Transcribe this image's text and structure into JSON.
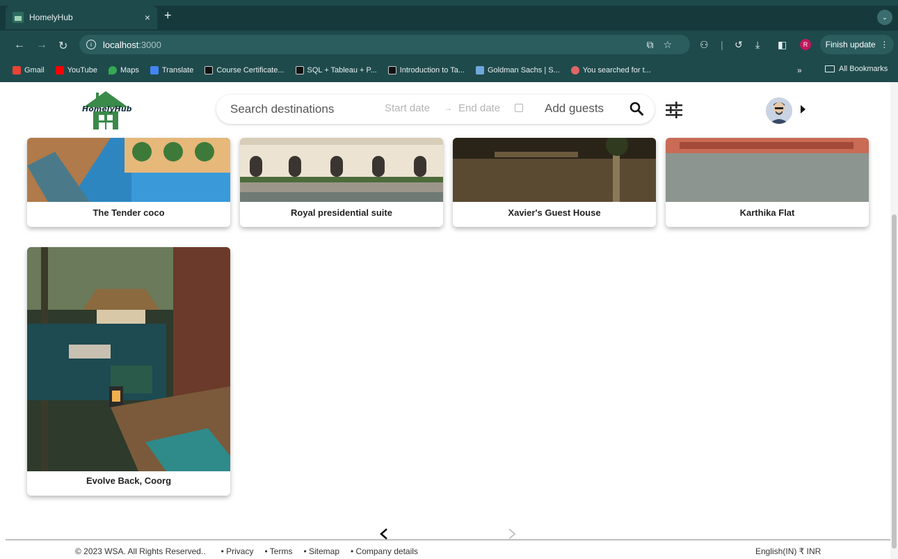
{
  "browser": {
    "tab_title": "HomelyHub",
    "tab_close": "×",
    "new_tab": "+",
    "url_host": "localhost",
    "url_port": ":3000",
    "finish_update": "Finish update",
    "profile_initial": "R",
    "bookmarks": [
      {
        "label": "Gmail",
        "color": "#ea4335"
      },
      {
        "label": "YouTube",
        "color": "#ff0000"
      },
      {
        "label": "Maps",
        "color": "#34a853"
      },
      {
        "label": "Translate",
        "color": "#4285f4"
      },
      {
        "label": "Course Certificate...",
        "color": "#111111"
      },
      {
        "label": "SQL + Tableau + P...",
        "color": "#111111"
      },
      {
        "label": "Introduction to Ta...",
        "color": "#111111"
      },
      {
        "label": "Goldman Sachs | S...",
        "color": "#6fa8dc"
      },
      {
        "label": "You searched for t...",
        "color": "#e06666"
      }
    ],
    "bookmarks_more": "»",
    "all_bookmarks": "All Bookmarks"
  },
  "header": {
    "logo_text": "HomelyHub",
    "search_placeholder": "Search destinations",
    "start_date": "Start date",
    "date_arrow": "→",
    "end_date": "End date",
    "guests_placeholder": "Add guests"
  },
  "listings": [
    {
      "title": "The Tender coco"
    },
    {
      "title": "Royal presidential suite"
    },
    {
      "title": "Xavier's Guest House"
    },
    {
      "title": "Karthika Flat"
    },
    {
      "title": "Evolve Back, Coorg"
    }
  ],
  "footer": {
    "copyright": "© 2023 WSA. All Rights Reserved..",
    "links": [
      "• Privacy",
      "• Terms",
      "• Sitemap",
      "• Company details"
    ],
    "locale": "English(IN) ₹ INR"
  },
  "colors": {
    "browser_frame": "#1f4a4c",
    "accent_green": "#3a8a4a"
  }
}
